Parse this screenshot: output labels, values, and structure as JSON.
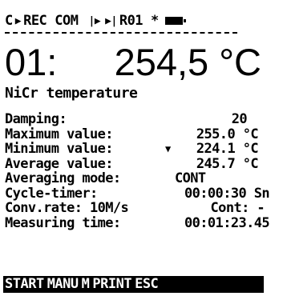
{
  "status_bar": {
    "channel_flag": "C",
    "rec": "REC",
    "com": "COM",
    "device": "R01",
    "star": "*",
    "icons": [
      "play-icon",
      "step-forward-icon",
      "skip-forward-icon",
      "battery-icon"
    ]
  },
  "reading": {
    "channel": "01:",
    "value": "254,5 °C"
  },
  "sensor_label": "NiCr temperature",
  "parameters": [
    {
      "label": "Damping:",
      "value": "20"
    },
    {
      "label": "Maximum value:",
      "value": "255.0 °C"
    },
    {
      "label": "Minimum value:",
      "value": "224.1 °C"
    },
    {
      "label": "Average value:",
      "value": "245.7 °C"
    },
    {
      "label": "Averaging mode:",
      "value": "CONT"
    },
    {
      "label": "Cycle-timer:",
      "value": "00:00:30 Sn"
    },
    {
      "label": "Conv.rate: 10M/s",
      "value": "Cont: -"
    },
    {
      "label": "Measuring time:",
      "value": "00:01:23.45"
    }
  ],
  "softkeys": [
    "START",
    "MANU",
    "M",
    "PRINT",
    "ESC"
  ]
}
